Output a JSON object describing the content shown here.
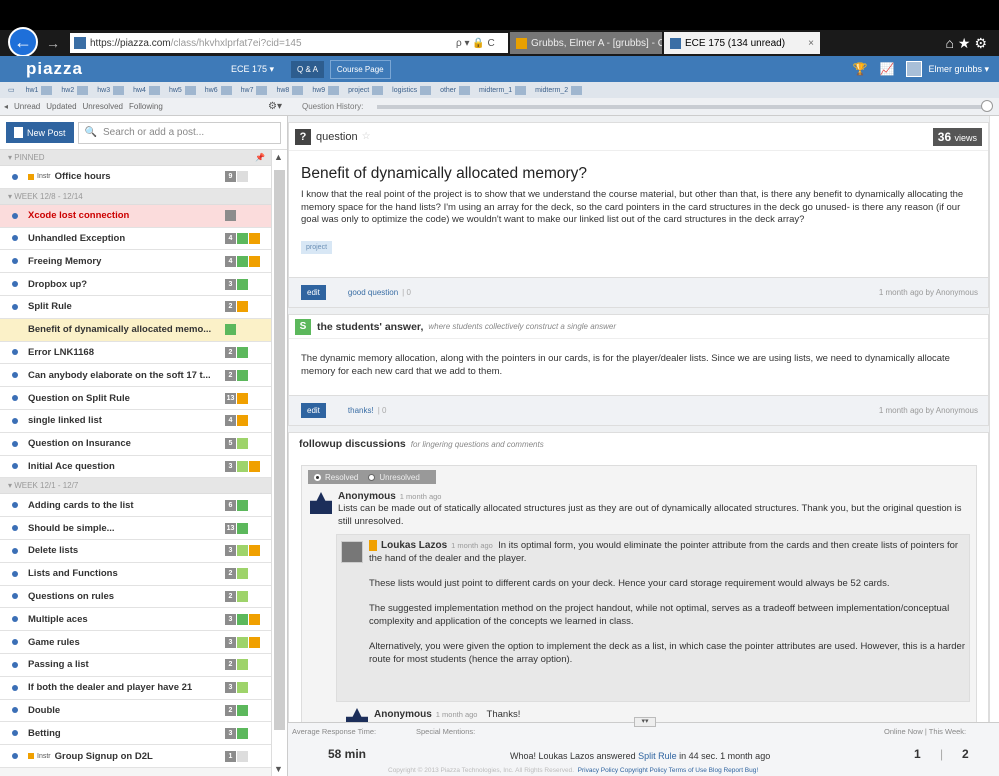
{
  "browser": {
    "url_main": "https://piazza.com",
    "url_path": "/class/hkvhxlprfat7ei?cid=145",
    "addr_controls": "ρ ▾ 🔒 C",
    "tab1": "Grubbs, Elmer A - [grubbs] - O...",
    "tab2": "ECE 175 (134 unread)",
    "icons": "⌂★⚙"
  },
  "nav": {
    "logo": "piazza",
    "class_name": "ECE 175 ▾",
    "tab_qa": "Q & A",
    "tab_course": "Course Page",
    "user": "Elmer grubbs ▾"
  },
  "folders": [
    "hw1",
    "hw2",
    "hw3",
    "hw4",
    "hw5",
    "hw6",
    "hw7",
    "hw8",
    "hw9",
    "project",
    "logistics",
    "other",
    "midterm_1",
    "midterm_2"
  ],
  "filters": {
    "unread": "Unread",
    "updated": "Updated",
    "unresolved": "Unresolved",
    "following": "Following"
  },
  "question_history": "Question History:",
  "left": {
    "new_post": "New Post",
    "search_placeholder": "Search or add a post...",
    "pinned_label": "▾ PINNED",
    "instr_label": "Instr",
    "week1_label": "▾ WEEK 12/8 - 12/14",
    "week2_label": "▾ WEEK 12/1 - 12/7",
    "pinned": [
      {
        "title": "Office hours",
        "badges": [
          "g9",
          "w"
        ]
      }
    ],
    "week1": [
      {
        "title": "Xcode lost connection",
        "badges": [
          "g"
        ]
      },
      {
        "title": "Unhandled Exception",
        "badges": [
          "g4",
          "s",
          "i"
        ]
      },
      {
        "title": "Freeing Memory",
        "badges": [
          "g4",
          "s",
          "i"
        ]
      },
      {
        "title": "Dropbox up?",
        "badges": [
          "g3",
          "s"
        ]
      },
      {
        "title": "Split Rule",
        "badges": [
          "g2",
          "i"
        ]
      },
      {
        "title": "Benefit of dynamically allocated memo...",
        "badges": [
          "s"
        ]
      },
      {
        "title": "Error LNK1168",
        "badges": [
          "g2",
          "s"
        ]
      },
      {
        "title": "Can anybody elaborate on the soft 17 t...",
        "badges": [
          "g2",
          "s"
        ]
      },
      {
        "title": "Question on Split Rule",
        "badges": [
          "g13",
          "i"
        ]
      },
      {
        "title": "single linked list",
        "badges": [
          "g4",
          "i"
        ]
      },
      {
        "title": "Question on Insurance",
        "badges": [
          "g5",
          "n"
        ]
      },
      {
        "title": "Initial Ace question",
        "badges": [
          "g3",
          "n",
          "i"
        ]
      }
    ],
    "week2": [
      {
        "title": "Adding cards to the list",
        "badges": [
          "g6",
          "s"
        ]
      },
      {
        "title": "Should be simple...",
        "badges": [
          "g13",
          "s"
        ]
      },
      {
        "title": "Delete lists",
        "badges": [
          "g3",
          "n",
          "i"
        ]
      },
      {
        "title": "Lists and Functions",
        "badges": [
          "g2",
          "n"
        ]
      },
      {
        "title": "Questions on rules",
        "badges": [
          "g2",
          "n"
        ]
      },
      {
        "title": "Multiple aces",
        "badges": [
          "g3",
          "s",
          "i"
        ]
      },
      {
        "title": "Game rules",
        "badges": [
          "g3",
          "n",
          "i"
        ]
      },
      {
        "title": "Passing a list",
        "badges": [
          "g2",
          "n"
        ]
      },
      {
        "title": "If both the dealer and player have 21",
        "badges": [
          "g3",
          "n"
        ]
      },
      {
        "title": "Double",
        "badges": [
          "g2",
          "s"
        ]
      },
      {
        "title": "Betting",
        "badges": [
          "g3",
          "s"
        ]
      },
      {
        "title": "Group Signup on D2L",
        "badges": [
          "g1",
          "w"
        ]
      }
    ]
  },
  "question": {
    "label": "question",
    "views": "36",
    "views_label": "views",
    "title": "Benefit of dynamically allocated memory?",
    "body": "I know that the real point of the project is to show that we understand the course material, but other than that, is there any benefit to dynamically allocating the memory space for the hand lists? I'm using an array for the deck, so the card pointers in the card structures in the deck go unused- is there any reason (if our goal was only to optimize the code) we wouldn't want to make our linked list out of the card structures in the deck array?",
    "tag": "project",
    "edit": "edit",
    "good": "good question",
    "good_count": "| 0",
    "meta": "1 month ago by Anonymous"
  },
  "answer": {
    "icon": "S",
    "label": "the students' answer,",
    "sub": "where students collectively construct a single answer",
    "body": "The dynamic memory allocation, along with the pointers in our cards, is for the player/dealer lists. Since we are using lists, we need to dynamically allocate memory for each new card that we add to them.",
    "edit": "edit",
    "thanks": "thanks!",
    "thanks_count": "| 0",
    "meta": "1 month ago by Anonymous"
  },
  "followup": {
    "label": "followup discussions",
    "sub": "for lingering questions and comments",
    "resolved": "Resolved",
    "unresolved": "Unresolved",
    "f1_name": "Anonymous",
    "f1_time": "1 month ago",
    "f1_text": "Lists can be made out of statically allocated structures just as they are out of dynamically allocated structures. Thank you, but the original question is still unresolved.",
    "r_name": "Loukas Lazos",
    "r_time": "1 month ago",
    "r_p1": "In its optimal form, you would eliminate  the pointer attribute from the cards and then create lists of pointers for the hand of the dealer and the player.",
    "r_p2": "These lists would just point to different cards on your deck. Hence your card storage requirement would always be 52 cards.",
    "r_p3": "The suggested implementation method on the project handout, while not optimal, serves as a tradeoff between implementation/conceptual complexity and application of the concepts we learned in class.",
    "r_p4": "Alternatively, you were given the option to implement the deck as a list, in which case the pointer attributes are used. However, this is a harder route for most students (hence the array option).",
    "f2_name": "Anonymous",
    "f2_time": "1 month ago",
    "f2_text": "Thanks!"
  },
  "bottom": {
    "avg_label": "Average Response Time:",
    "avg_value": "58 min",
    "mentions_label": "Special Mentions:",
    "mention_pre": "Whoa! Loukas Lazos answered",
    "mention_link": "Split Rule",
    "mention_post": "in 44 sec. 1 month ago",
    "online_label": "Online Now  |  This Week:",
    "online_now": "1",
    "online_week": "2",
    "collapse": "▾▾",
    "copyright": "Copyright © 2013 Piazza Technologies, Inc. All Rights Reserved.",
    "links": "Privacy Policy  Copyright Policy  Terms of Use  Blog  Report Bug!"
  },
  "colors": {
    "accent": "#3e7ab8",
    "selected_row": "#fbf1c8",
    "unread_row": "#fbdcdc",
    "student_answer": "#5cb85c",
    "instructor": "#f0a000"
  }
}
